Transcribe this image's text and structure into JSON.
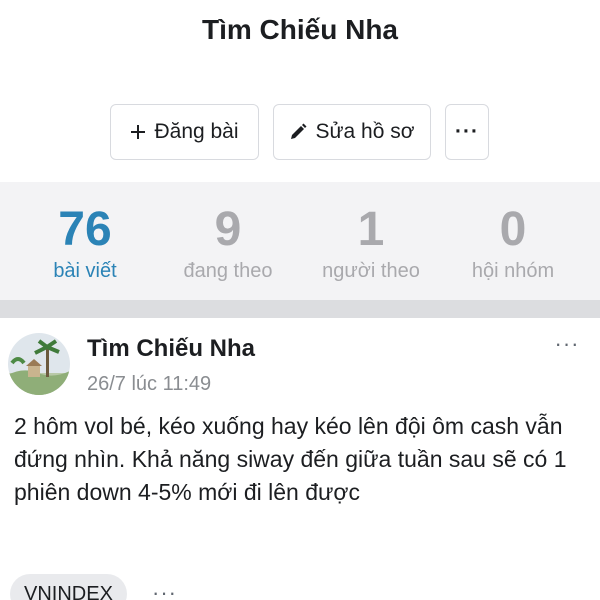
{
  "profile": {
    "name": "Tìm Chiếu Nha"
  },
  "actions": {
    "post_label": "Đăng bài",
    "edit_label": "Sửa hồ sơ",
    "more_label": "···"
  },
  "stats": [
    {
      "value": "76",
      "label": "bài viết"
    },
    {
      "value": "9",
      "label": "đang theo"
    },
    {
      "value": "1",
      "label": "người theo"
    },
    {
      "value": "0",
      "label": "hội nhóm"
    }
  ],
  "post": {
    "author": "Tìm Chiếu Nha",
    "time": "26/7 lúc 11:49",
    "menu_label": "···",
    "content": "2 hôm vol bé, kéo xuống hay kéo lên đội ôm cash vẫn đứng nhìn. Khả năng siway đến giữa tuần sau sẽ có 1 phiên down 4-5% mới đi lên được",
    "tag": "VNINDEX",
    "tag_more": "···"
  },
  "colors": {
    "accent": "#2b83b6",
    "muted": "#a9a9ad",
    "stats_bg": "#f3f3f5",
    "divider": "#dcdde0"
  }
}
